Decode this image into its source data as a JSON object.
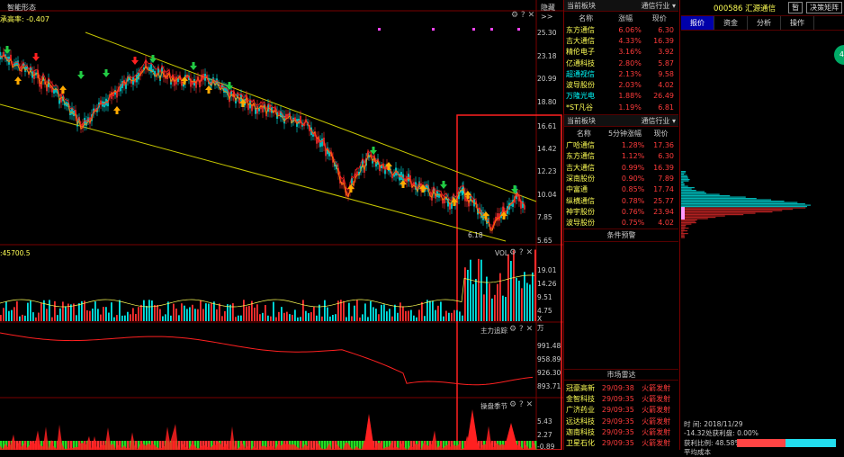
{
  "chart": {
    "title": "智能形态",
    "subtitle": "承高率: -0.407",
    "collapse_label": "隐藏>>",
    "price_ticks": [
      "25.30",
      "23.18",
      "20.99",
      "18.80",
      "16.61",
      "14.42",
      "12.23",
      "10.04",
      "7.85",
      "5.65"
    ],
    "low_label": "6.18",
    "volume_label": ":45700.5",
    "vol_panel_title": "VOL",
    "vol_ticks": [
      "19.01",
      "14.26",
      "9.51",
      "4.75"
    ],
    "vol_unit": "X万",
    "main_panel_title": "主力追踪",
    "main_ticks": [
      "991.48",
      "958.89",
      "926.30",
      "893.71"
    ],
    "season_panel_title": "操盘季节",
    "season_ticks": [
      "5.43",
      "2.27",
      "-0.89"
    ]
  },
  "sector1": {
    "header_left": "当前板块",
    "header_right": "通信行业",
    "col_name": "名称",
    "col_pct": "涨幅",
    "col_price": "现价",
    "rows": [
      {
        "name": "东方通信",
        "pct": "6.06%",
        "price": "6.30"
      },
      {
        "name": "吉大通信",
        "pct": "4.33%",
        "price": "16.39"
      },
      {
        "name": "精伦电子",
        "pct": "3.16%",
        "price": "3.92"
      },
      {
        "name": "亿通科技",
        "pct": "2.80%",
        "price": "5.87"
      },
      {
        "name": "超通视信",
        "pct": "2.13%",
        "price": "9.58"
      },
      {
        "name": "波导股份",
        "pct": "2.03%",
        "price": "4.02"
      },
      {
        "name": "万隆光电",
        "pct": "1.88%",
        "price": "26.49"
      },
      {
        "name": "*ST凡谷",
        "pct": "1.19%",
        "price": "6.81"
      }
    ]
  },
  "sector2": {
    "header_left": "当前板块",
    "header_right": "通信行业",
    "col_name": "名称",
    "col_pct": "5分钟涨幅",
    "col_price": "现价",
    "rows": [
      {
        "name": "广哈通信",
        "pct": "1.28%",
        "price": "17.36"
      },
      {
        "name": "东方通信",
        "pct": "1.12%",
        "price": "6.30"
      },
      {
        "name": "吉大通信",
        "pct": "0.99%",
        "price": "16.39"
      },
      {
        "name": "深南股份",
        "pct": "0.90%",
        "price": "7.89"
      },
      {
        "name": "中富通",
        "pct": "0.85%",
        "price": "17.74"
      },
      {
        "name": "纵横通信",
        "pct": "0.78%",
        "price": "25.77"
      },
      {
        "name": "神宇股份",
        "pct": "0.76%",
        "price": "23.94"
      },
      {
        "name": "波导股份",
        "pct": "0.75%",
        "price": "4.02"
      }
    ],
    "footer": "条件预警"
  },
  "radar": {
    "title": "市场雷达",
    "rows": [
      {
        "name": "冠豪高新",
        "time": "29/09:38",
        "event": "火箭发射"
      },
      {
        "name": "金智科技",
        "time": "29/09:35",
        "event": "火箭发射"
      },
      {
        "name": "广济药业",
        "time": "29/09:35",
        "event": "火箭发射"
      },
      {
        "name": "远达科技",
        "time": "29/09:35",
        "event": "火箭发射"
      },
      {
        "name": "迦南科技",
        "time": "29/09:35",
        "event": "火箭发射"
      },
      {
        "name": "卫星石化",
        "time": "29/09:35",
        "event": "火箭发射"
      }
    ]
  },
  "stock": {
    "code_name": "000586 汇源通信",
    "btn1": "暂",
    "btn2": "决策矩阵",
    "tabs": [
      "报价",
      "资金",
      "分析",
      "操作"
    ],
    "side_badge": "40",
    "time_label": "时",
    "date_label": "间: 2018/11/29",
    "profit_line": "-14.32处获利盘: 0.00%",
    "ratio_line": "获利比例: 48.58%",
    "cost_line": "平均成本"
  }
}
